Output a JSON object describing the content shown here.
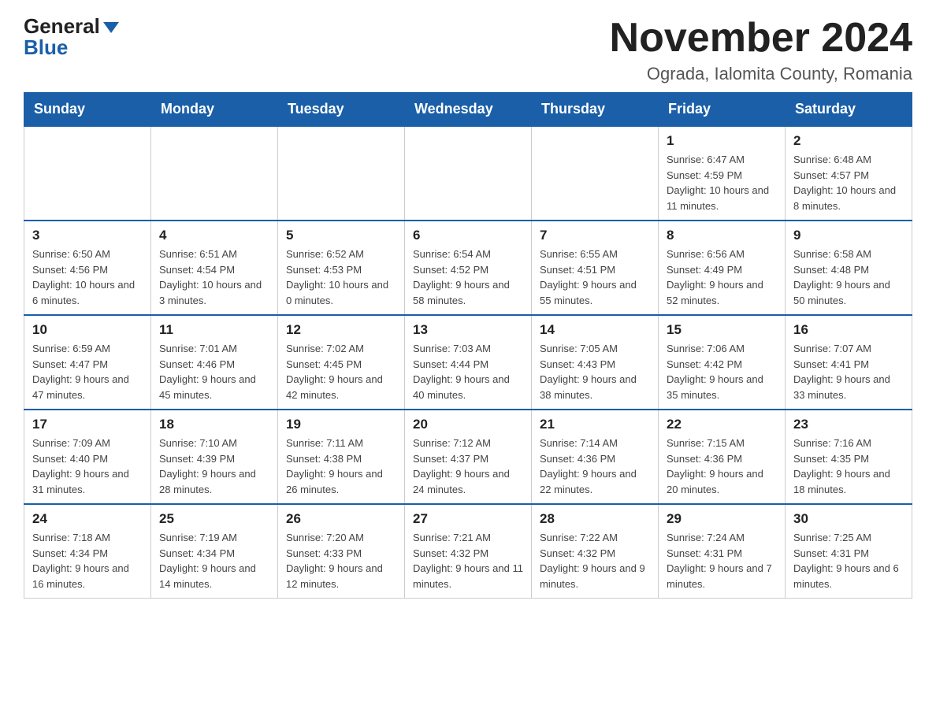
{
  "header": {
    "logo_general": "General",
    "logo_blue": "Blue",
    "month_title": "November 2024",
    "location": "Ograda, Ialomita County, Romania"
  },
  "days_of_week": [
    "Sunday",
    "Monday",
    "Tuesday",
    "Wednesday",
    "Thursday",
    "Friday",
    "Saturday"
  ],
  "weeks": [
    [
      {
        "day": "",
        "info": ""
      },
      {
        "day": "",
        "info": ""
      },
      {
        "day": "",
        "info": ""
      },
      {
        "day": "",
        "info": ""
      },
      {
        "day": "",
        "info": ""
      },
      {
        "day": "1",
        "info": "Sunrise: 6:47 AM\nSunset: 4:59 PM\nDaylight: 10 hours and 11 minutes."
      },
      {
        "day": "2",
        "info": "Sunrise: 6:48 AM\nSunset: 4:57 PM\nDaylight: 10 hours and 8 minutes."
      }
    ],
    [
      {
        "day": "3",
        "info": "Sunrise: 6:50 AM\nSunset: 4:56 PM\nDaylight: 10 hours and 6 minutes."
      },
      {
        "day": "4",
        "info": "Sunrise: 6:51 AM\nSunset: 4:54 PM\nDaylight: 10 hours and 3 minutes."
      },
      {
        "day": "5",
        "info": "Sunrise: 6:52 AM\nSunset: 4:53 PM\nDaylight: 10 hours and 0 minutes."
      },
      {
        "day": "6",
        "info": "Sunrise: 6:54 AM\nSunset: 4:52 PM\nDaylight: 9 hours and 58 minutes."
      },
      {
        "day": "7",
        "info": "Sunrise: 6:55 AM\nSunset: 4:51 PM\nDaylight: 9 hours and 55 minutes."
      },
      {
        "day": "8",
        "info": "Sunrise: 6:56 AM\nSunset: 4:49 PM\nDaylight: 9 hours and 52 minutes."
      },
      {
        "day": "9",
        "info": "Sunrise: 6:58 AM\nSunset: 4:48 PM\nDaylight: 9 hours and 50 minutes."
      }
    ],
    [
      {
        "day": "10",
        "info": "Sunrise: 6:59 AM\nSunset: 4:47 PM\nDaylight: 9 hours and 47 minutes."
      },
      {
        "day": "11",
        "info": "Sunrise: 7:01 AM\nSunset: 4:46 PM\nDaylight: 9 hours and 45 minutes."
      },
      {
        "day": "12",
        "info": "Sunrise: 7:02 AM\nSunset: 4:45 PM\nDaylight: 9 hours and 42 minutes."
      },
      {
        "day": "13",
        "info": "Sunrise: 7:03 AM\nSunset: 4:44 PM\nDaylight: 9 hours and 40 minutes."
      },
      {
        "day": "14",
        "info": "Sunrise: 7:05 AM\nSunset: 4:43 PM\nDaylight: 9 hours and 38 minutes."
      },
      {
        "day": "15",
        "info": "Sunrise: 7:06 AM\nSunset: 4:42 PM\nDaylight: 9 hours and 35 minutes."
      },
      {
        "day": "16",
        "info": "Sunrise: 7:07 AM\nSunset: 4:41 PM\nDaylight: 9 hours and 33 minutes."
      }
    ],
    [
      {
        "day": "17",
        "info": "Sunrise: 7:09 AM\nSunset: 4:40 PM\nDaylight: 9 hours and 31 minutes."
      },
      {
        "day": "18",
        "info": "Sunrise: 7:10 AM\nSunset: 4:39 PM\nDaylight: 9 hours and 28 minutes."
      },
      {
        "day": "19",
        "info": "Sunrise: 7:11 AM\nSunset: 4:38 PM\nDaylight: 9 hours and 26 minutes."
      },
      {
        "day": "20",
        "info": "Sunrise: 7:12 AM\nSunset: 4:37 PM\nDaylight: 9 hours and 24 minutes."
      },
      {
        "day": "21",
        "info": "Sunrise: 7:14 AM\nSunset: 4:36 PM\nDaylight: 9 hours and 22 minutes."
      },
      {
        "day": "22",
        "info": "Sunrise: 7:15 AM\nSunset: 4:36 PM\nDaylight: 9 hours and 20 minutes."
      },
      {
        "day": "23",
        "info": "Sunrise: 7:16 AM\nSunset: 4:35 PM\nDaylight: 9 hours and 18 minutes."
      }
    ],
    [
      {
        "day": "24",
        "info": "Sunrise: 7:18 AM\nSunset: 4:34 PM\nDaylight: 9 hours and 16 minutes."
      },
      {
        "day": "25",
        "info": "Sunrise: 7:19 AM\nSunset: 4:34 PM\nDaylight: 9 hours and 14 minutes."
      },
      {
        "day": "26",
        "info": "Sunrise: 7:20 AM\nSunset: 4:33 PM\nDaylight: 9 hours and 12 minutes."
      },
      {
        "day": "27",
        "info": "Sunrise: 7:21 AM\nSunset: 4:32 PM\nDaylight: 9 hours and 11 minutes."
      },
      {
        "day": "28",
        "info": "Sunrise: 7:22 AM\nSunset: 4:32 PM\nDaylight: 9 hours and 9 minutes."
      },
      {
        "day": "29",
        "info": "Sunrise: 7:24 AM\nSunset: 4:31 PM\nDaylight: 9 hours and 7 minutes."
      },
      {
        "day": "30",
        "info": "Sunrise: 7:25 AM\nSunset: 4:31 PM\nDaylight: 9 hours and 6 minutes."
      }
    ]
  ]
}
